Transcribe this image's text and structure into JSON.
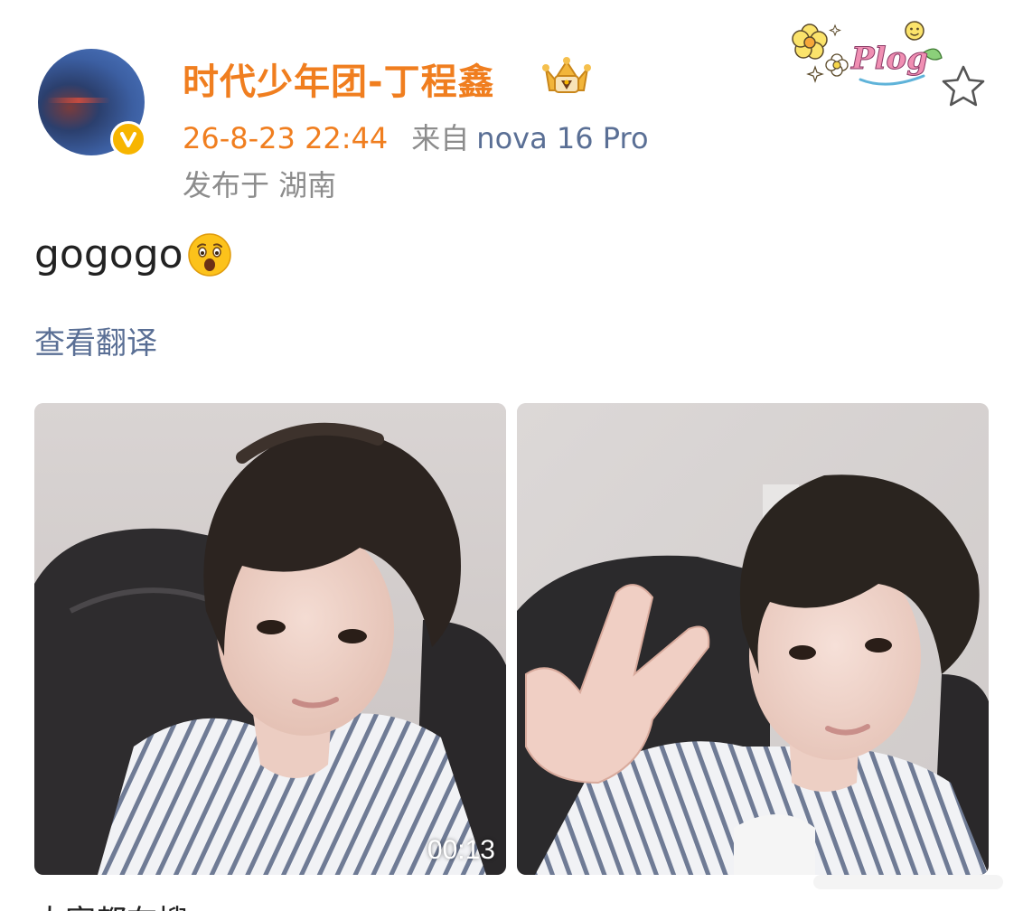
{
  "post": {
    "author": {
      "name": "时代少年团-丁程鑫",
      "avatar_icon": "avatar-image",
      "badge_icon": "vip-verified-icon",
      "badge_text": "V",
      "badge_color": "#f7b500",
      "name_color": "#f07e1f",
      "title_icon": "crown-medal-icon"
    },
    "timestamp": "26-8-23 22:44",
    "source_prefix": "来自",
    "device": "nova 16 Pro",
    "location": "发布于 湖南",
    "text": "gogogo",
    "text_emoji_icon": "surprised-face-emoji",
    "translate_label": "查看翻译",
    "sticker_icon": "plog-sticker",
    "sticker_text": "Plog",
    "favorite_icon": "star-outline-icon",
    "media": [
      {
        "kind": "video",
        "icon": "selfie-photo",
        "duration": "00:13"
      },
      {
        "kind": "image",
        "icon": "peace-sign-selfie-photo"
      }
    ],
    "link_color": "#5a6f95",
    "meta_color": "#8c8c8c"
  }
}
